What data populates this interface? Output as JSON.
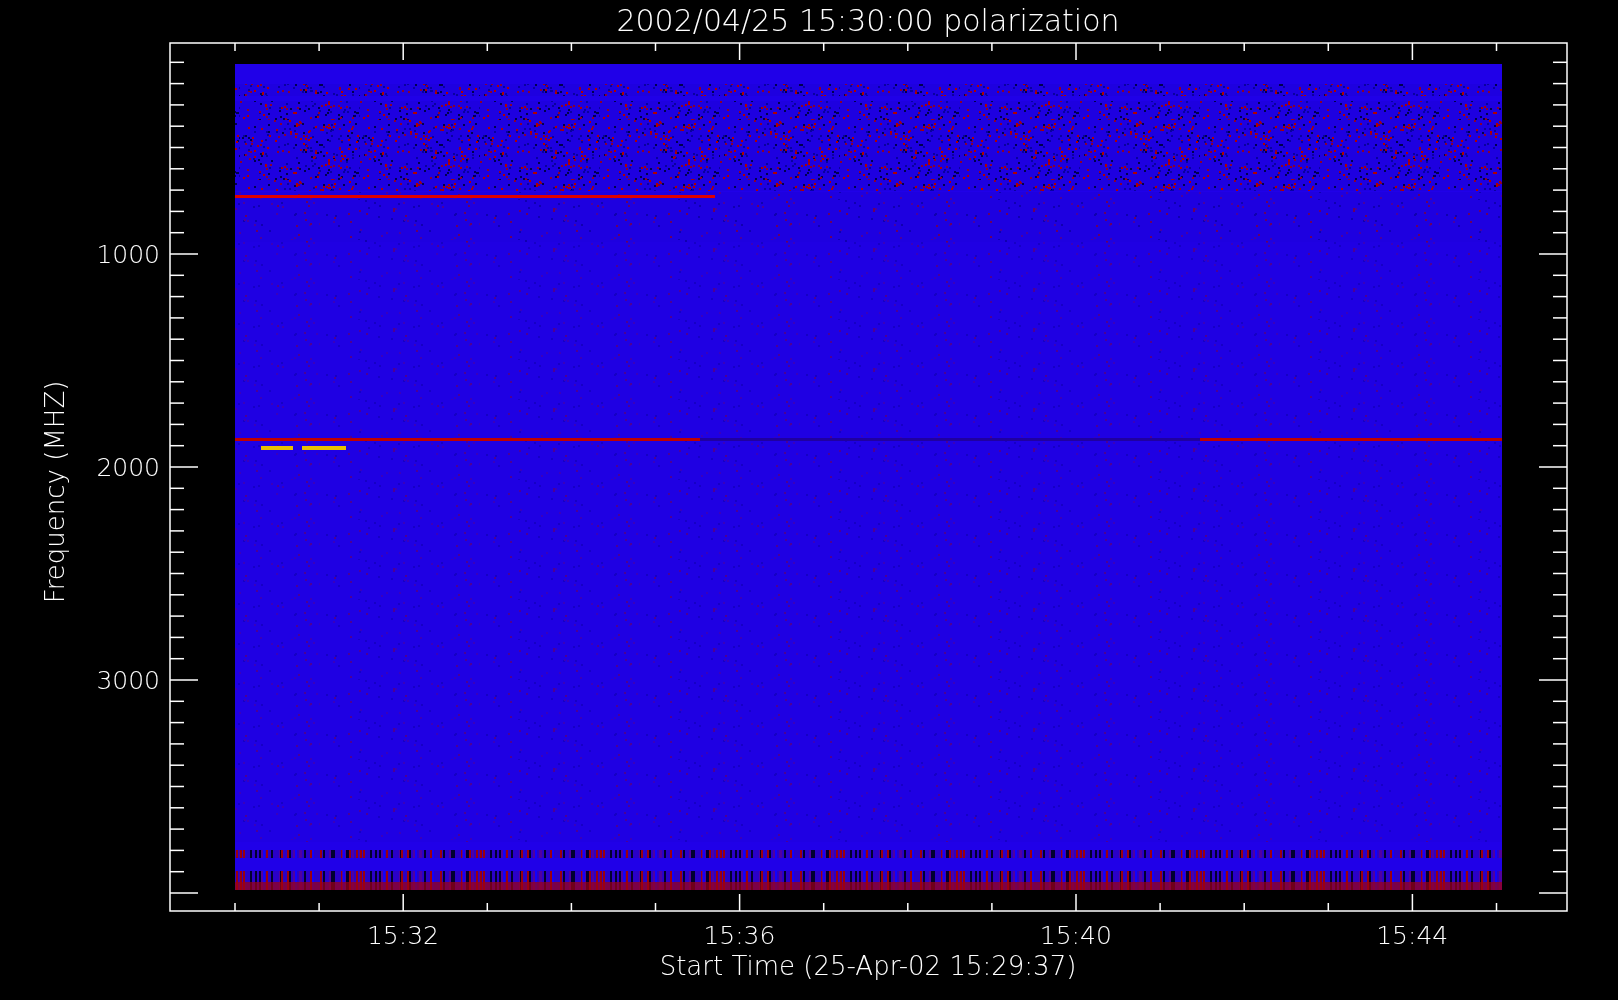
{
  "plot": {
    "title": "2002/04/25 15:30:00 polarization",
    "ylabel": "Frequency (MHZ)",
    "yticks": [
      "1000",
      "2000",
      "3000"
    ],
    "xticks": [
      "15:32",
      "15:36",
      "15:40",
      "15:44"
    ],
    "xlabel": "Start Time (25-Apr-02 15:29:37)"
  }
}
